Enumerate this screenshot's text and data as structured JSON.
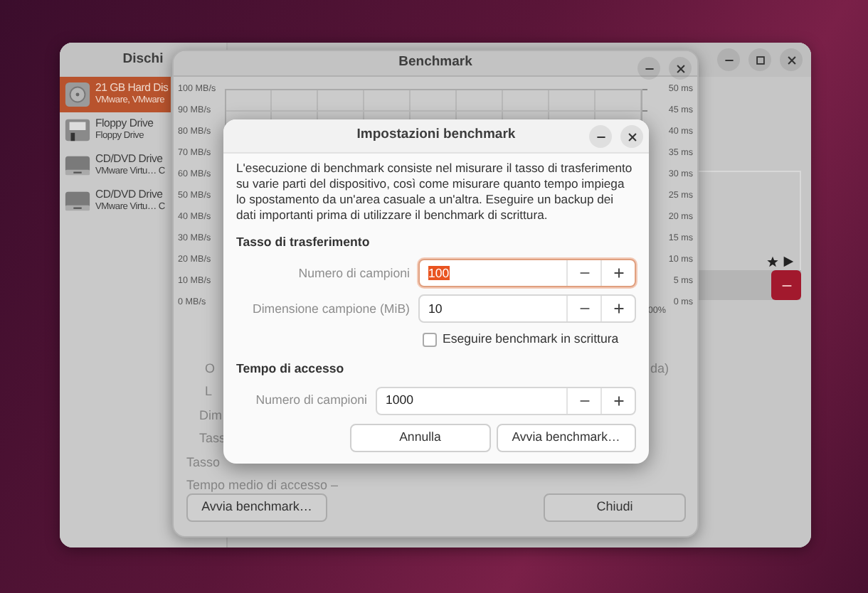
{
  "disks_window": {
    "title": "Dischi",
    "drives": [
      {
        "kind": "hdd",
        "name": "21 GB Hard Dis",
        "detail": "VMware, VMware",
        "selected": true
      },
      {
        "kind": "floppy",
        "name": "Floppy Drive",
        "detail": "Floppy Drive",
        "selected": false
      },
      {
        "kind": "optical",
        "name": "CD/DVD Drive",
        "detail": "VMware Virtu… C",
        "selected": false
      },
      {
        "kind": "optical",
        "name": "CD/DVD Drive",
        "detail": "VMware Virtu… C",
        "selected": false
      }
    ]
  },
  "benchmark_window": {
    "title": "Benchmark",
    "left_axis": [
      "100 MB/s",
      "90 MB/s",
      "80 MB/s",
      "70 MB/s",
      "60 MB/s",
      "50 MB/s",
      "40 MB/s",
      "30 MB/s",
      "20 MB/s",
      "10 MB/s",
      "0 MB/s"
    ],
    "right_axis": [
      "50 ms",
      "45 ms",
      "40 ms",
      "35 ms",
      "30 ms",
      "25 ms",
      "20 ms",
      "15 ms",
      "10 ms",
      "5 ms",
      "0 ms"
    ],
    "x_axis_end": "00%",
    "info_lines": [
      {
        "label": "O",
        "value": "da)"
      },
      {
        "label": "L"
      },
      {
        "label": "Dim"
      },
      {
        "label": "Tass"
      },
      {
        "label": "Tasso"
      },
      {
        "label": "Tempo medio di accesso –"
      }
    ],
    "buttons": [
      "Avvia benchmark…",
      "Chiudi"
    ]
  },
  "settings_dialog": {
    "title": "Impostazioni benchmark",
    "description": "L'esecuzione di benchmark consiste nel misurare il tasso di trasferimento su varie parti del dispositivo, così come misurare quanto tempo impiega lo spostamento da un'area casuale a un'altra. Eseguire un backup dei dati importanti prima di utilizzare il benchmark di scrittura.",
    "sections": [
      {
        "heading": "Tasso di trasferimento",
        "fields": [
          {
            "label": "Numero di campioni",
            "value": "100",
            "focused": true
          },
          {
            "label": "Dimensione campione (MiB)",
            "value": "10",
            "focused": false
          }
        ],
        "checkbox": {
          "label": "Eseguire benchmark in scrittura",
          "checked": false
        }
      },
      {
        "heading": "Tempo di accesso",
        "fields": [
          {
            "label": "Numero di campioni",
            "value": "1000",
            "focused": false
          }
        ]
      }
    ],
    "buttons": [
      "Annulla",
      "Avvia benchmark…"
    ]
  }
}
